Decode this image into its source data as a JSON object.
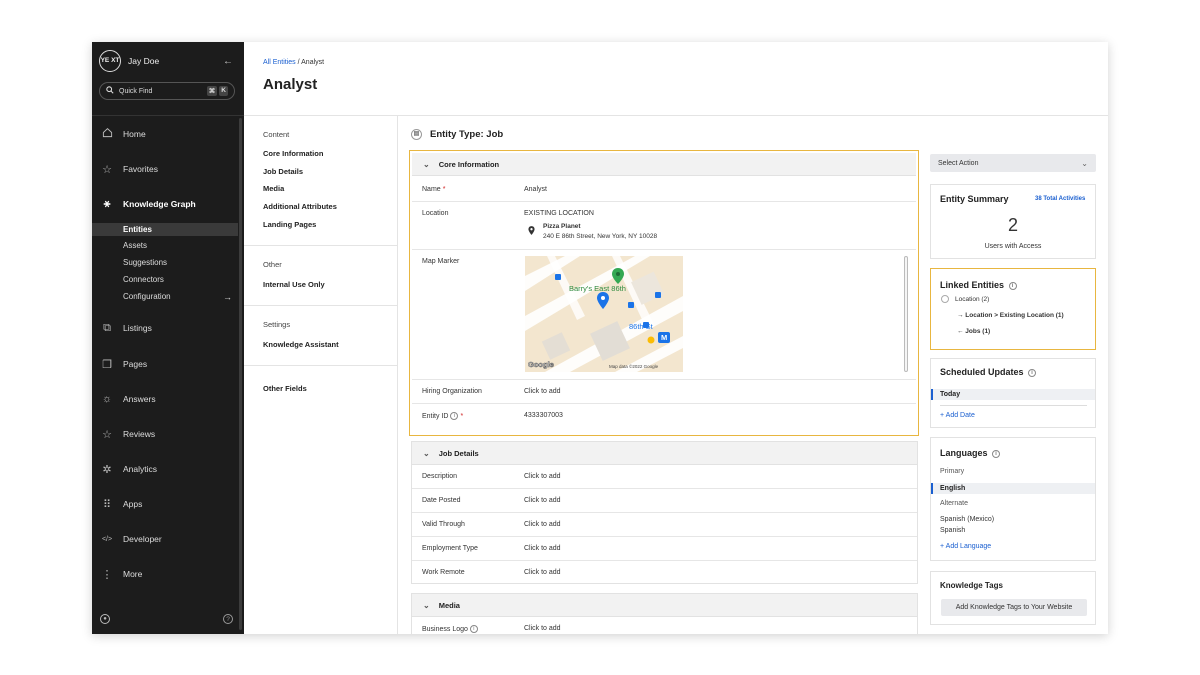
{
  "sidebar": {
    "user_initials": "YE XT",
    "user_name": "Jay Doe",
    "collapse_icon": "←",
    "quick_find": "Quick Find",
    "quick_find_keys": [
      "⌘",
      "K"
    ],
    "nav": [
      {
        "label": "Home",
        "icon": "home-icon"
      },
      {
        "label": "Favorites",
        "icon": "star-icon"
      },
      {
        "label": "Knowledge Graph",
        "icon": "knowledge-graph-icon"
      },
      {
        "label": "Listings",
        "icon": "listings-icon"
      },
      {
        "label": "Pages",
        "icon": "pages-icon"
      },
      {
        "label": "Answers",
        "icon": "answers-icon"
      },
      {
        "label": "Reviews",
        "icon": "reviews-icon"
      },
      {
        "label": "Analytics",
        "icon": "analytics-icon"
      },
      {
        "label": "Apps",
        "icon": "apps-icon"
      },
      {
        "label": "Developer",
        "icon": "developer-icon"
      },
      {
        "label": "More",
        "icon": "more-icon"
      }
    ],
    "sub_items": [
      "Entities",
      "Assets",
      "Suggestions",
      "Connectors",
      "Configuration"
    ]
  },
  "header": {
    "breadcrumb_link": "All Entities",
    "breadcrumb_current": " / Analyst",
    "title": "Analyst"
  },
  "subnav": {
    "content_heading": "Content",
    "content_items": [
      "Core Information",
      "Job Details",
      "Media",
      "Additional Attributes",
      "Landing Pages"
    ],
    "other_heading": "Other",
    "other_items": [
      "Internal Use Only"
    ],
    "settings_heading": "Settings",
    "settings_items": [
      "Knowledge Assistant"
    ],
    "other_fields": "Other Fields"
  },
  "main": {
    "entity_type": "Entity Type: Job",
    "core": {
      "title": "Core Information",
      "name_label": "Name",
      "name_value": "Analyst",
      "location_label": "Location",
      "location_value": "EXISTING LOCATION",
      "location_name": "Pizza Planet",
      "location_address": "240 E 86th Street, New York, NY 10028",
      "map_label": "Map Marker",
      "map_place1": "Barry's East 86th",
      "map_place2": "86th St",
      "map_credit": "Map data ©2022 Google",
      "map_logo": "Google",
      "map_metro": "M",
      "hiring_label": "Hiring Organization",
      "hiring_value": "Click to add",
      "entity_id_label": "Entity ID",
      "entity_id_value": "4333307003"
    },
    "job": {
      "title": "Job Details",
      "rows": [
        {
          "label": "Description",
          "value": "Click to add"
        },
        {
          "label": "Date Posted",
          "value": "Click to add"
        },
        {
          "label": "Valid Through",
          "value": "Click to add"
        },
        {
          "label": "Employment Type",
          "value": "Click to add"
        },
        {
          "label": "Work Remote",
          "value": "Click to add"
        }
      ]
    },
    "media": {
      "title": "Media",
      "logo_label": "Business Logo",
      "logo_value": "Click to add"
    }
  },
  "right": {
    "select_action": "Select Action",
    "summary_title": "Entity Summary",
    "summary_link": "38 Total Activities",
    "summary_count": "2",
    "summary_caption": "Users with Access",
    "linked_title": "Linked Entities",
    "linked_location": "Location (2)",
    "linked_to": "→ Location > Existing Location (1)",
    "linked_from": "← Jobs (1)",
    "scheduled_title": "Scheduled Updates",
    "scheduled_today": "Today",
    "add_date": "+ Add Date",
    "languages_title": "Languages",
    "primary_label": "Primary",
    "primary_lang": "English",
    "alternate_label": "Alternate",
    "alternate_lang1": "Spanish (Mexico)",
    "alternate_lang2": "Spanish",
    "add_language": "+ Add Language",
    "tags_title": "Knowledge Tags",
    "tags_button": "Add Knowledge Tags to Your Website"
  },
  "colors": {
    "sidebar_bg": "#1c1c1c",
    "accent_blue": "#1a5fd0",
    "highlight": "#e8b640",
    "required": "#d02020"
  }
}
